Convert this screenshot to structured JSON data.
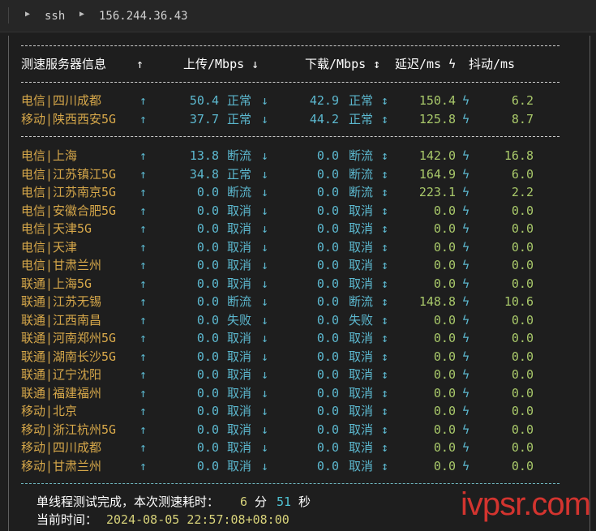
{
  "titlebar": {
    "fragment": ")",
    "crumbs": [
      "ssh",
      "156.244.36.43"
    ]
  },
  "header": {
    "col_server": "测速服务器信息",
    "col_up_arrow": "↑",
    "col_upload": "上传/Mbps ↓",
    "col_download": "下载/Mbps ↕",
    "col_latency": "延迟/ms ϟ",
    "col_jitter": "抖动/ms"
  },
  "group1": [
    {
      "loc": "电信|四川成都",
      "up": "50.4",
      "up_status": "正常",
      "down": "42.9",
      "down_status": "正常",
      "latency": "150.4",
      "jitter": "6.2"
    },
    {
      "loc": "移动|陕西西安5G",
      "up": "37.7",
      "up_status": "正常",
      "down": "44.2",
      "down_status": "正常",
      "latency": "125.8",
      "jitter": "8.7"
    }
  ],
  "group2": [
    {
      "loc": "电信|上海",
      "up": "13.8",
      "up_status": "断流",
      "down": "0.0",
      "down_status": "断流",
      "latency": "142.0",
      "jitter": "16.8"
    },
    {
      "loc": "电信|江苏镇江5G",
      "up": "34.8",
      "up_status": "正常",
      "down": "0.0",
      "down_status": "断流",
      "latency": "164.9",
      "jitter": "6.0"
    },
    {
      "loc": "电信|江苏南京5G",
      "up": "0.0",
      "up_status": "断流",
      "down": "0.0",
      "down_status": "断流",
      "latency": "223.1",
      "jitter": "2.2"
    },
    {
      "loc": "电信|安徽合肥5G",
      "up": "0.0",
      "up_status": "取消",
      "down": "0.0",
      "down_status": "取消",
      "latency": "0.0",
      "jitter": "0.0"
    },
    {
      "loc": "电信|天津5G",
      "up": "0.0",
      "up_status": "取消",
      "down": "0.0",
      "down_status": "取消",
      "latency": "0.0",
      "jitter": "0.0"
    },
    {
      "loc": "电信|天津",
      "up": "0.0",
      "up_status": "取消",
      "down": "0.0",
      "down_status": "取消",
      "latency": "0.0",
      "jitter": "0.0"
    },
    {
      "loc": "电信|甘肃兰州",
      "up": "0.0",
      "up_status": "取消",
      "down": "0.0",
      "down_status": "取消",
      "latency": "0.0",
      "jitter": "0.0"
    },
    {
      "loc": "联通|上海5G",
      "up": "0.0",
      "up_status": "取消",
      "down": "0.0",
      "down_status": "取消",
      "latency": "0.0",
      "jitter": "0.0"
    },
    {
      "loc": "联通|江苏无锡",
      "up": "0.0",
      "up_status": "断流",
      "down": "0.0",
      "down_status": "断流",
      "latency": "148.8",
      "jitter": "10.6"
    },
    {
      "loc": "联通|江西南昌",
      "up": "0.0",
      "up_status": "失败",
      "down": "0.0",
      "down_status": "失败",
      "latency": "0.0",
      "jitter": "0.0"
    },
    {
      "loc": "联通|河南郑州5G",
      "up": "0.0",
      "up_status": "取消",
      "down": "0.0",
      "down_status": "取消",
      "latency": "0.0",
      "jitter": "0.0"
    },
    {
      "loc": "联通|湖南长沙5G",
      "up": "0.0",
      "up_status": "取消",
      "down": "0.0",
      "down_status": "取消",
      "latency": "0.0",
      "jitter": "0.0"
    },
    {
      "loc": "联通|辽宁沈阳",
      "up": "0.0",
      "up_status": "取消",
      "down": "0.0",
      "down_status": "取消",
      "latency": "0.0",
      "jitter": "0.0"
    },
    {
      "loc": "联通|福建福州",
      "up": "0.0",
      "up_status": "取消",
      "down": "0.0",
      "down_status": "取消",
      "latency": "0.0",
      "jitter": "0.0"
    },
    {
      "loc": "移动|北京",
      "up": "0.0",
      "up_status": "取消",
      "down": "0.0",
      "down_status": "取消",
      "latency": "0.0",
      "jitter": "0.0"
    },
    {
      "loc": "移动|浙江杭州5G",
      "up": "0.0",
      "up_status": "取消",
      "down": "0.0",
      "down_status": "取消",
      "latency": "0.0",
      "jitter": "0.0"
    },
    {
      "loc": "移动|四川成都",
      "up": "0.0",
      "up_status": "取消",
      "down": "0.0",
      "down_status": "取消",
      "latency": "0.0",
      "jitter": "0.0"
    },
    {
      "loc": "移动|甘肃兰州",
      "up": "0.0",
      "up_status": "取消",
      "down": "0.0",
      "down_status": "取消",
      "latency": "0.0",
      "jitter": "0.0"
    }
  ],
  "footer": {
    "done_prefix": "单线程测试完成，本次测速耗时：",
    "minutes": "6",
    "min_unit": "分",
    "seconds": "51",
    "sec_unit": "秒",
    "time_label": "当前时间：",
    "time_value": "2024-08-05 22:57:08+08:00"
  },
  "watermark": "ivpsr.com",
  "colors": {
    "location": "#d7a84a",
    "speed": "#5cb8cf",
    "latency": "#a9c96a",
    "watermark": "#d3342f"
  }
}
